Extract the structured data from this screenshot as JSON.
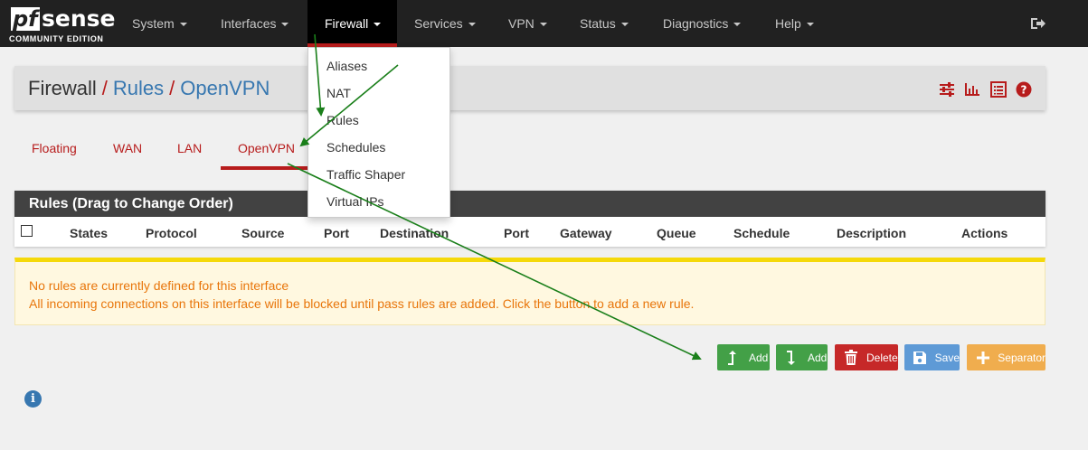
{
  "brand": {
    "name_pf": "pf",
    "name_sense": "sense",
    "edition": "COMMUNITY EDITION"
  },
  "nav": {
    "items": [
      {
        "label": "System"
      },
      {
        "label": "Interfaces"
      },
      {
        "label": "Firewall"
      },
      {
        "label": "Services"
      },
      {
        "label": "VPN"
      },
      {
        "label": "Status"
      },
      {
        "label": "Diagnostics"
      },
      {
        "label": "Help"
      }
    ],
    "active": "Firewall"
  },
  "dropdown": {
    "items": [
      {
        "label": "Aliases"
      },
      {
        "label": "NAT"
      },
      {
        "label": "Rules"
      },
      {
        "label": "Schedules"
      },
      {
        "label": "Traffic Shaper"
      },
      {
        "label": "Virtual IPs"
      }
    ]
  },
  "breadcrumb": {
    "root": "Firewall",
    "sep1": "/",
    "second": "Rules",
    "sep2": "/",
    "third": "OpenVPN"
  },
  "header_icons": [
    "sliders-icon",
    "bar-chart-icon",
    "list-icon",
    "help-icon"
  ],
  "tabs": [
    {
      "label": "Floating"
    },
    {
      "label": "WAN"
    },
    {
      "label": "LAN"
    },
    {
      "label": "OpenVPN"
    }
  ],
  "active_tab": "OpenVPN",
  "rules": {
    "heading": "Rules (Drag to Change Order)",
    "columns": [
      "States",
      "Protocol",
      "Source",
      "Port",
      "Destination",
      "Port",
      "Gateway",
      "Queue",
      "Schedule",
      "Description",
      "Actions"
    ]
  },
  "alert": {
    "line1": "No rules are currently defined for this interface",
    "line2": "All incoming connections on this interface will be blocked until pass rules are added. Click the button to add a new rule."
  },
  "buttons": {
    "add_top": "Add",
    "add_bottom": "Add",
    "delete": "Delete",
    "save": "Save",
    "separator": "Separator"
  },
  "colors": {
    "navbar": "#212121",
    "accent_red": "#b71c1c",
    "link_blue": "#3777b0",
    "green": "#43a047",
    "annotation_arrow": "#1a7f1a"
  }
}
